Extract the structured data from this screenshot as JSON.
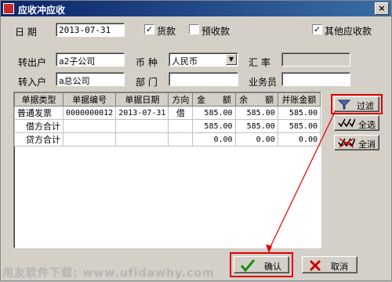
{
  "window": {
    "title": "应收冲应收",
    "close_label": "×"
  },
  "date": {
    "label": "日   期",
    "value": "2013-07-31"
  },
  "options": [
    {
      "label": "货款",
      "checked": true,
      "mark": "✓"
    },
    {
      "label": "预收款",
      "checked": false,
      "mark": ""
    },
    {
      "label": "其他应收款",
      "checked": true,
      "mark": "✓"
    }
  ],
  "form": {
    "out_label": "转出户",
    "out_value": "a2子公司",
    "in_label": "转入户",
    "in_value": "a总公司",
    "currency_label": "币   种",
    "currency_value": "人民币",
    "dept_label": "部   门",
    "dept_value": "",
    "rate_label": "汇   率",
    "rate_value": "",
    "clerk_label": "业务员",
    "clerk_value": ""
  },
  "table": {
    "headers": [
      "单据类型",
      "单据编号",
      "单据日期",
      "方向",
      "金　　额",
      "余　　额",
      "并账金额"
    ],
    "rows": [
      [
        "普通发票",
        "0000000012",
        "2013-07-31",
        "借",
        "585.00",
        "585.00",
        "585.00"
      ],
      [
        "　借方合计",
        "",
        "",
        "",
        "585.00",
        "585.00",
        "585.00"
      ],
      [
        "　贷方合计",
        "",
        "",
        "",
        "0.00",
        "0.00",
        "0.00"
      ]
    ]
  },
  "side_buttons": {
    "filter": "过滤",
    "select_all": "全选",
    "clear_all": "全消"
  },
  "footer": {
    "ok": "确认",
    "cancel": "取消"
  },
  "watermark": "用友软件下载: www.ufidawhy.com"
}
